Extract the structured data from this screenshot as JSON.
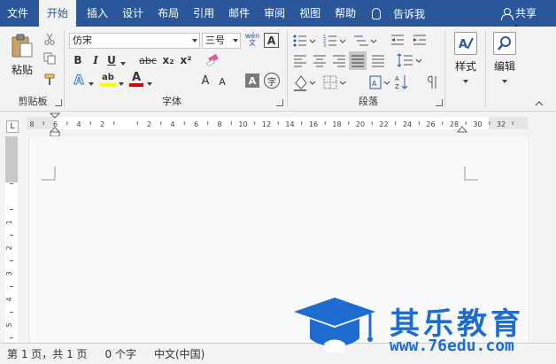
{
  "tabs": [
    "文件",
    "开始",
    "插入",
    "设计",
    "布局",
    "引用",
    "邮件",
    "审阅",
    "视图",
    "帮助"
  ],
  "active_tab": "开始",
  "tell_me": "告诉我",
  "share": "共享",
  "clipboard": {
    "paste": "粘贴",
    "group": "剪贴板"
  },
  "font": {
    "group": "字体",
    "name": "仿宋",
    "size": "三号",
    "wen_glyph": "wén\n文",
    "bold": "B",
    "italic": "I",
    "underline": "U",
    "strike": "abc",
    "subscript": "x₂",
    "superscript": "x²",
    "effects": "A",
    "highlight": "ab",
    "color": "A",
    "grow": "A",
    "shrink": "A",
    "char_shade": "A",
    "enclose": "字"
  },
  "paragraph": {
    "group": "段落"
  },
  "styles": {
    "label": "样式"
  },
  "editing": {
    "label": "编辑"
  },
  "ruler": {
    "corner": "L",
    "h_ticks": [
      "8",
      "6",
      "4",
      "2",
      "",
      "2",
      "4",
      "6",
      "8",
      "10",
      "12",
      "14",
      "16",
      "18",
      "20",
      "22",
      "24",
      "26",
      "28",
      "30",
      "32"
    ],
    "v_ticks": [
      "1",
      "1",
      "",
      "1",
      "2",
      "3",
      "4",
      "5"
    ]
  },
  "status": {
    "page": "第 1 页，共 1 页",
    "words": "0 个字",
    "language": "中文(中国)"
  },
  "watermark": {
    "title": "其乐教育",
    "url": "www.76edu.com"
  },
  "colors": {
    "accent": "#2b579a",
    "highlight": "#ffff00",
    "font_color": "#e00000",
    "watermark": "#1f6cd1"
  }
}
